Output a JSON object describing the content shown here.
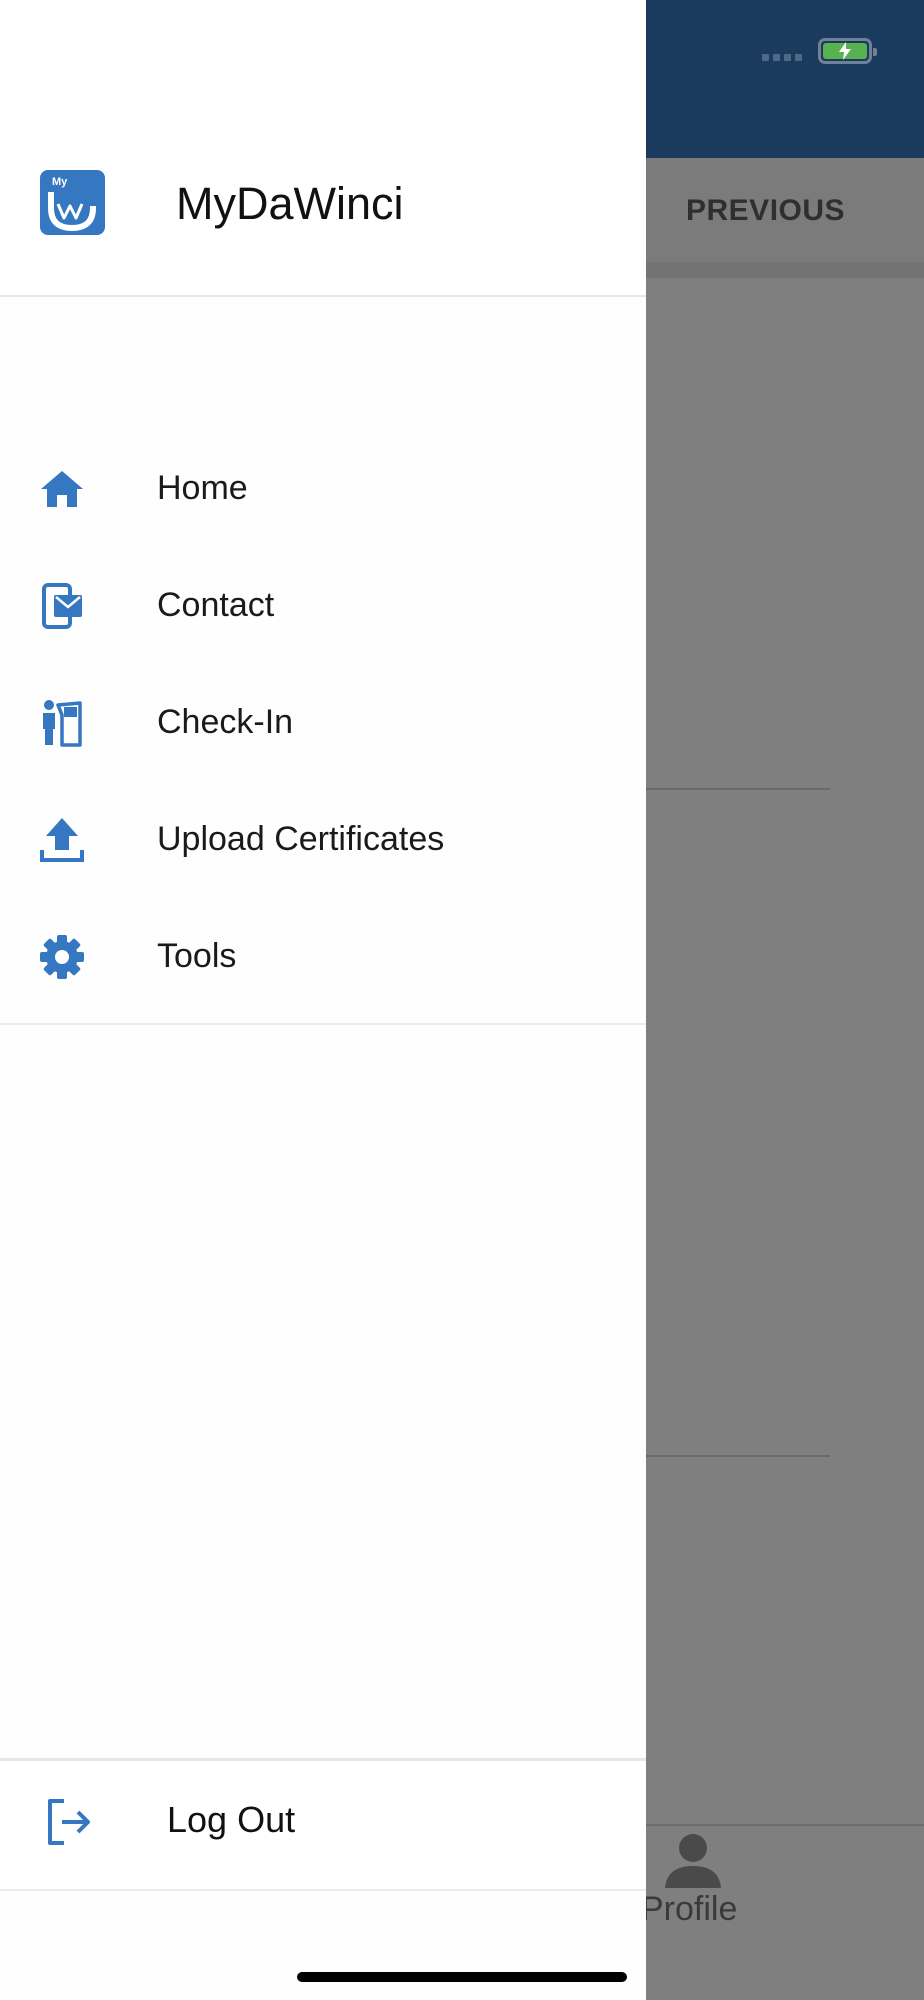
{
  "drawer": {
    "app_title": "MyDaWinci",
    "logo_text": "My",
    "items": [
      {
        "label": "Home",
        "icon": "home-icon"
      },
      {
        "label": "Contact",
        "icon": "contact-mail-icon"
      },
      {
        "label": "Check-In",
        "icon": "check-in-kiosk-icon"
      },
      {
        "label": "Upload Certificates",
        "icon": "upload-icon"
      },
      {
        "label": "Tools",
        "icon": "gear-icon"
      }
    ],
    "logout": {
      "label": "Log Out",
      "icon": "logout-icon"
    }
  },
  "background": {
    "tab_label": "PREVIOUS",
    "bottom_nav_label": "Profile"
  },
  "colors": {
    "accent": "#3577c1",
    "header": "#1a3a5e",
    "overlay": "#7f7f7f",
    "battery": "#58b24f"
  }
}
